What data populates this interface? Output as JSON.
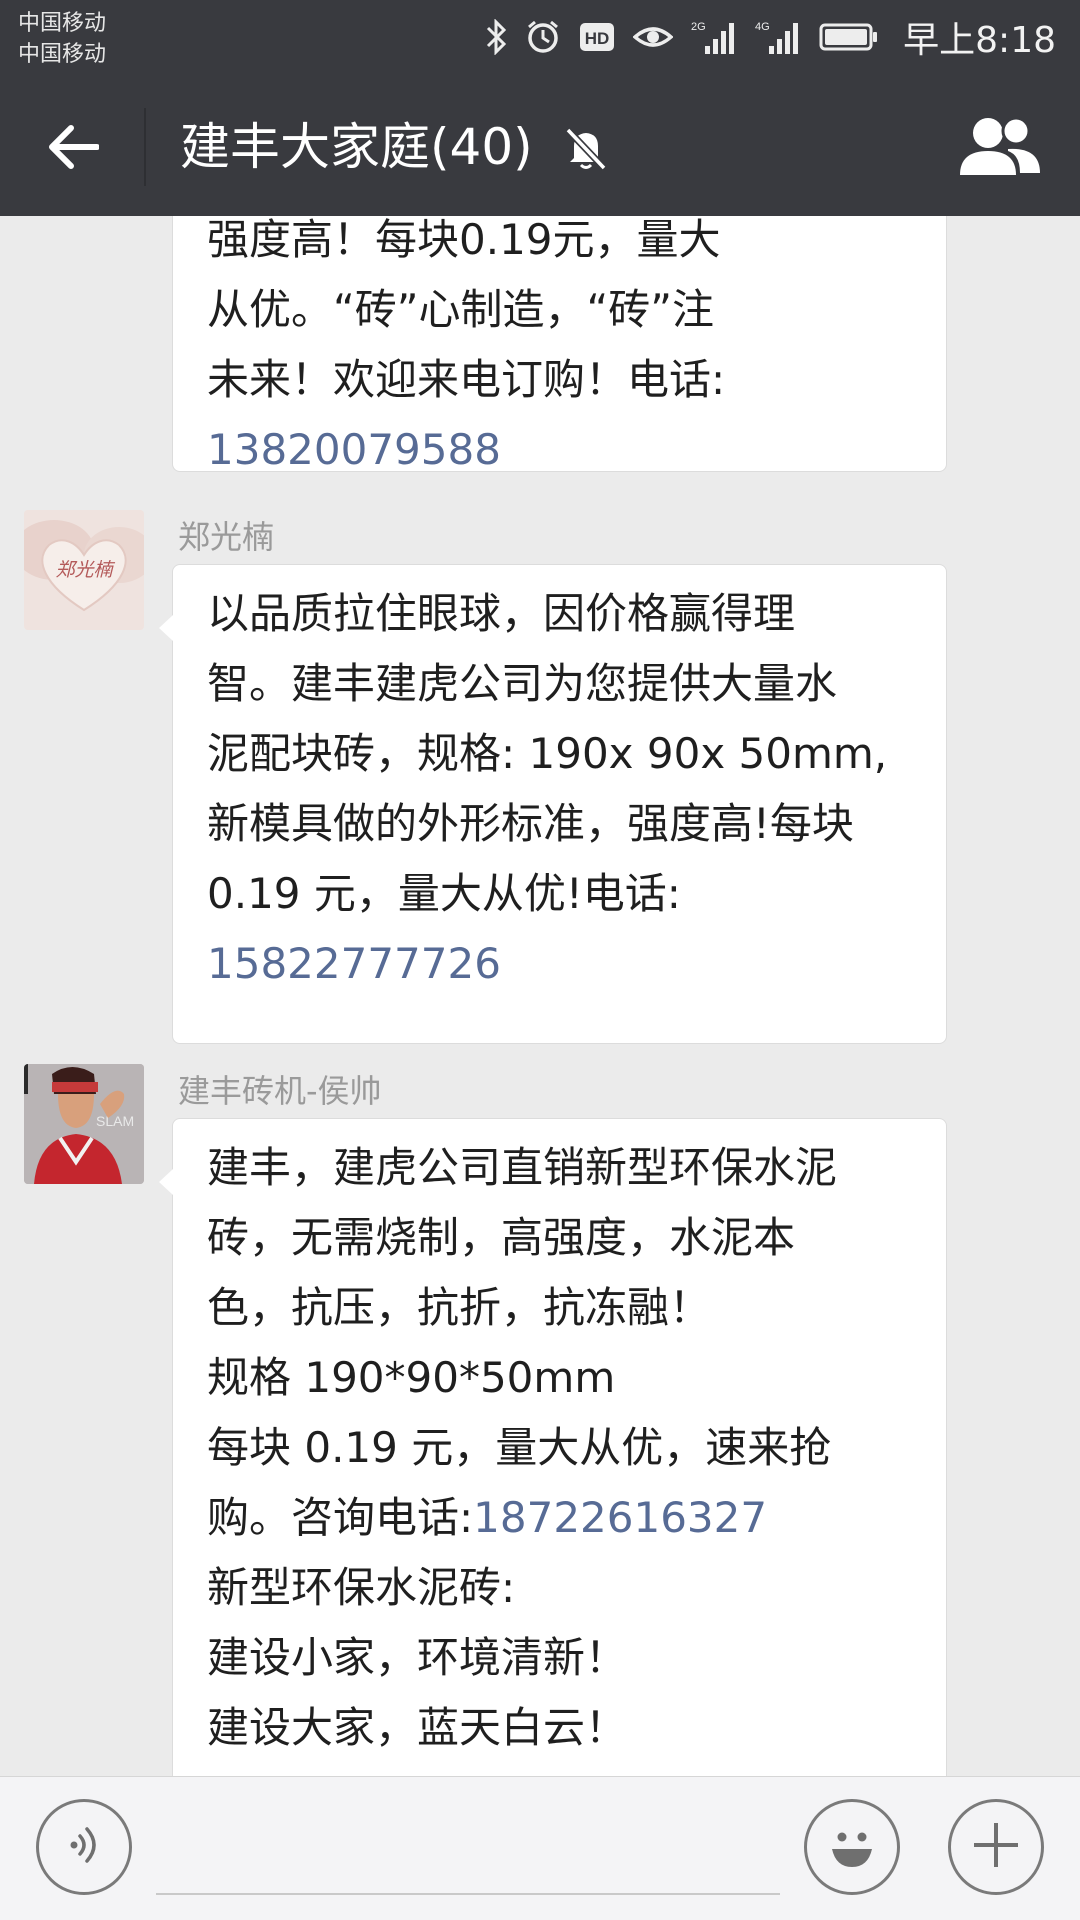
{
  "status_bar": {
    "carrier_1": "中国移动",
    "carrier_2": "中国移动",
    "hd_badge": "HD",
    "net_1": "2G",
    "net_2": "4G",
    "time": "早上8:18",
    "icons": [
      "bluetooth-icon",
      "alarm-icon",
      "hd-icon",
      "eye-icon",
      "signal-2g-icon",
      "signal-4g-icon",
      "battery-icon"
    ]
  },
  "header": {
    "title": "建丰大家庭(40)",
    "icons": [
      "back-arrow-icon",
      "mute-bell-icon",
      "group-members-icon"
    ]
  },
  "messages": [
    {
      "sender": "",
      "lines": [
        {
          "text": "强度高！每块0.19元，量大"
        },
        {
          "text": "从优。“砖”心制造，“砖”注"
        },
        {
          "text": "未来！欢迎来电订购！电话:"
        },
        {
          "phone": "13820079588"
        }
      ]
    },
    {
      "sender": "郑光楠",
      "lines": [
        {
          "text": "以品质拉住眼球，因价格赢得理"
        },
        {
          "text": "智。建丰建虎公司为您提供大量水"
        },
        {
          "text": "泥配块砖，规格: 190x 90x 50mm,"
        },
        {
          "text": "新模具做的外形标准，强度高!每块"
        },
        {
          "text": "0.19 元，量大从优!电话:"
        },
        {
          "phone": "15822777726"
        }
      ]
    },
    {
      "sender": "建丰砖机-侯帅",
      "lines": [
        {
          "text": "建丰，建虎公司直销新型环保水泥"
        },
        {
          "text": "砖，无需烧制，高强度，水泥本"
        },
        {
          "text": "色，抗压，抗折，抗冻融！"
        },
        {
          "text": "规格 190*90*50mm"
        },
        {
          "text": "每块 0.19 元，量大从优，速来抢"
        },
        {
          "text": "购。咨询电话:",
          "phone": "18722616327"
        },
        {
          "text": "新型环保水泥砖:"
        },
        {
          "text": "建设小家，环境清新！"
        },
        {
          "text": "建设大家，蓝天白云！"
        }
      ]
    }
  ],
  "avatars": {
    "avatar_1_text": "郑光楠",
    "avatar_2_text": "SLAM"
  },
  "input_bar": {
    "icons": [
      "voice-icon",
      "emoji-icon",
      "plus-icon"
    ]
  },
  "colors": {
    "bar_bg": "#393a3f",
    "chat_bg": "#ebebeb",
    "link": "#576b95",
    "bubble": "#ffffff"
  }
}
